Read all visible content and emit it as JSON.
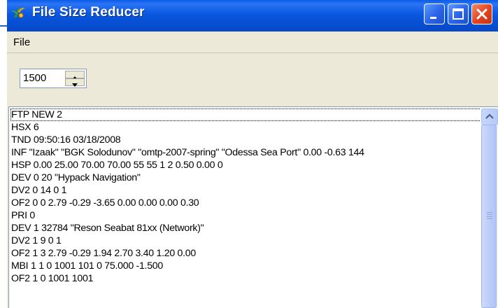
{
  "window": {
    "title": "File Size Reducer",
    "colors": {
      "titlebar": "#0a58e0",
      "close": "#e2421e",
      "chrome": "#ece9d8"
    }
  },
  "menu": {
    "file_label": "File"
  },
  "spinner": {
    "value": "1500"
  },
  "list": {
    "lines": [
      "FTP NEW 2",
      "HSX 6",
      "TND 09:50:16 03/18/2008",
      "INF \"Izaak\" \"BGK Solodunov\" \"omtp-2007-spring\" \"Odessa Sea Port\" 0.00 -0.63 144",
      "HSP 0.00 25.00 70.00 70.00 55 55 1 2 0.50 0.00 0",
      "DEV 0 20 \"Hypack Navigation\"",
      "DV2 0 14 0 1",
      "OF2 0 0 2.79 -0.29 -3.65 0.00 0.00 0.00 0.30",
      "PRI 0",
      "DEV 1 32784 \"Reson Seabat 81xx (Network)\"",
      "DV2 1 9 0 1",
      "OF2 1 3 2.79 -0.29 1.94 2.70 3.40 1.20 0.00",
      "MBI 1 1 0 1001 101 0 75.000 -1.500",
      "OF2 1 0 1001 1001"
    ]
  }
}
